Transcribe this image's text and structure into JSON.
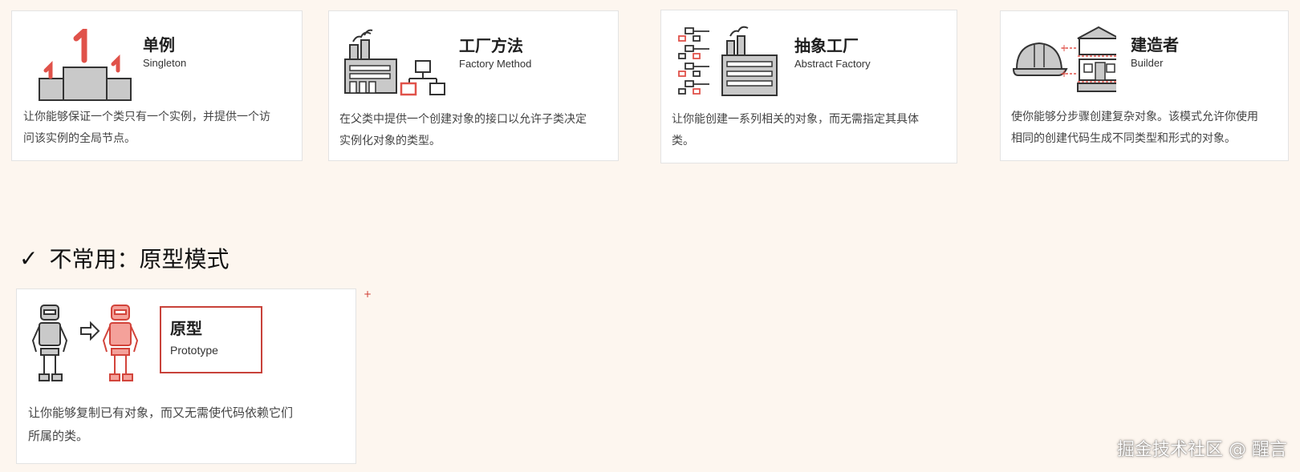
{
  "colors": {
    "accent": "#e0524a",
    "gray": "#c9c9c9",
    "outline": "#333333",
    "background": "#fdf6ef"
  },
  "patterns": [
    {
      "title": "单例",
      "subtitle": "Singleton",
      "icon": "podium-icon",
      "desc_lines": [
        "让你能够保证一个类只有一个实例，并提供一个访",
        "问该实例的全局节点。"
      ]
    },
    {
      "title": "工厂方法",
      "subtitle": "Factory Method",
      "icon": "factory-icon",
      "desc_lines": [
        "在父类中提供一个创建对象的接口以允许子类决定",
        "实例化对象的类型。"
      ]
    },
    {
      "title": "抽象工厂",
      "subtitle": "Abstract Factory",
      "icon": "abstract-factory-icon",
      "desc_lines": [
        "让你能创建一系列相关的对象，而无需指定其具体",
        "类。"
      ]
    },
    {
      "title": "建造者",
      "subtitle": "Builder",
      "icon": "builder-helmet-house-icon",
      "desc_lines": [
        "使你能够分步骤创建复杂对象。该模式允许你使用",
        "相同的创建代码生成不同类型和形式的对象。"
      ]
    }
  ],
  "section": {
    "check": "✓",
    "heading": "不常用：原型模式"
  },
  "prototype": {
    "title": "原型",
    "subtitle": "Prototype",
    "icon": "robot-clone-icon",
    "desc_lines": [
      "让你能够复制已有对象，而又无需使代码依赖它们",
      "所属的类。"
    ]
  },
  "plus_mark": "+",
  "watermark": "掘金技术社区 @ 醒言"
}
